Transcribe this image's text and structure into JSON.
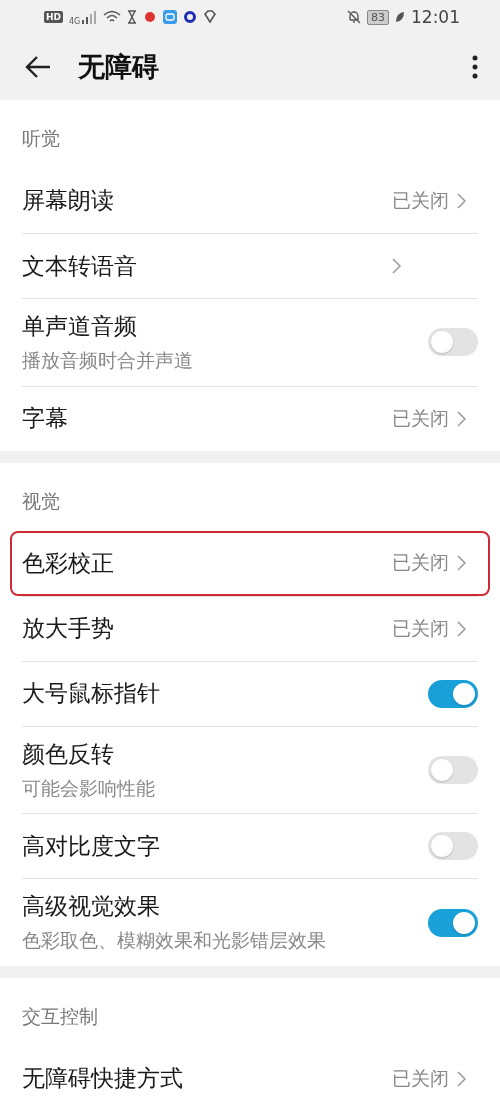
{
  "status_bar": {
    "hd": "HD",
    "network": "4G",
    "battery": "83",
    "time": "12:01"
  },
  "header": {
    "title": "无障碍"
  },
  "sections": [
    {
      "title": "听觉",
      "items": [
        {
          "kind": "link",
          "label": "屏幕朗读",
          "value": "已关闭",
          "highlighted": false
        },
        {
          "kind": "link",
          "label": "文本转语音",
          "highlighted": false
        },
        {
          "kind": "toggle",
          "label": "单声道音频",
          "subtitle": "播放音频时合并声道",
          "on": false,
          "highlighted": false
        },
        {
          "kind": "link",
          "label": "字幕",
          "value": "已关闭",
          "highlighted": false
        }
      ]
    },
    {
      "title": "视觉",
      "items": [
        {
          "kind": "link",
          "label": "色彩校正",
          "value": "已关闭",
          "highlighted": true
        },
        {
          "kind": "link",
          "label": "放大手势",
          "value": "已关闭",
          "highlighted": false
        },
        {
          "kind": "toggle",
          "label": "大号鼠标指针",
          "on": true,
          "highlighted": false
        },
        {
          "kind": "toggle",
          "label": "颜色反转",
          "subtitle": "可能会影响性能",
          "on": false,
          "highlighted": false
        },
        {
          "kind": "toggle",
          "label": "高对比度文字",
          "on": false,
          "highlighted": false
        },
        {
          "kind": "toggle",
          "label": "高级视觉效果",
          "subtitle": "色彩取色、模糊效果和光影错层效果",
          "on": true,
          "highlighted": false
        }
      ]
    },
    {
      "title": "交互控制",
      "items": [
        {
          "kind": "link",
          "label": "无障碍快捷方式",
          "value": "已关闭",
          "highlighted": false
        }
      ]
    }
  ]
}
